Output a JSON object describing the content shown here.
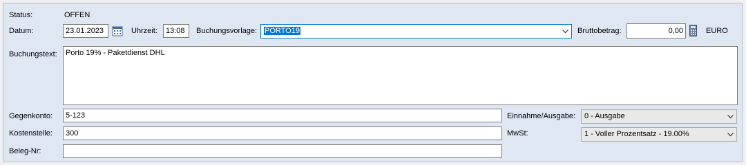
{
  "status": {
    "label": "Status:",
    "value": "OFFEN"
  },
  "datum": {
    "label": "Datum:",
    "value": "23.01.2023"
  },
  "uhrzeit": {
    "label": "Uhrzeit:",
    "value": "13:08"
  },
  "buchungsvorlage": {
    "label": "Buchungsvorlage:",
    "value": "PORTO19"
  },
  "bruttobetrag": {
    "label": "Bruttobetrag:",
    "value": "0,00",
    "currency": "EURO"
  },
  "buchungstext": {
    "label": "Buchungstext:",
    "value": "Porto 19% - Paketdienst DHL"
  },
  "gegenkonto": {
    "label": "Gegenkonto:",
    "value": "5-123"
  },
  "kostenstelle": {
    "label": "Kostenstelle:",
    "value": "300"
  },
  "beleg_nr": {
    "label": "Beleg-Nr:",
    "value": ""
  },
  "einnahme_ausgabe": {
    "label": "Einnahme/Ausgabe:",
    "value": "0 - Ausgabe"
  },
  "mwst": {
    "label": "MwSt:",
    "value": "1 - Voller Prozentsatz - 19.00%"
  },
  "icons": {
    "calendar": "calendar-icon",
    "calculator": "calculator-icon",
    "dropdown": "chevron-down-icon"
  },
  "colors": {
    "panel": "#dfe7f3",
    "selection": "#0078d7",
    "focus_border": "#0078d7"
  }
}
